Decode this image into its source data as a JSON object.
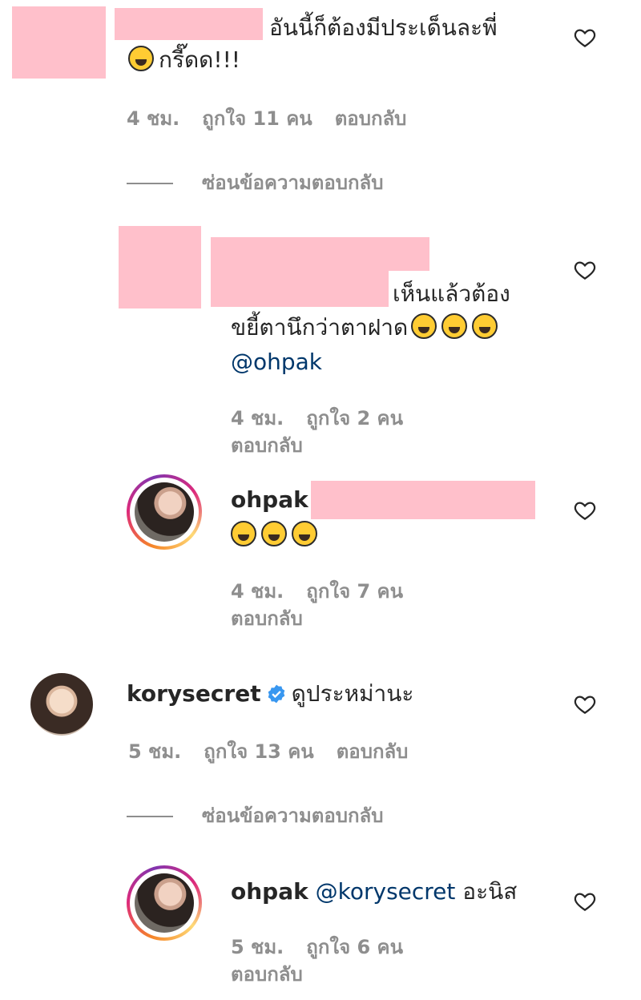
{
  "heart_icon": "heart-outline-icon",
  "colors": {
    "muted": "#8e8e8e",
    "mention": "#00376b",
    "redaction": "#ffc0cb",
    "verified": "#3897f0"
  },
  "comment1": {
    "text_line1": "อันนี้ก็ต้องมีประเด็นละพี่",
    "text_line2": "กรี๊ดด!!!",
    "time": "4 ชม.",
    "likes": "ถูกใจ 11 คน",
    "reply": "ตอบกลับ"
  },
  "hide_replies_1": "ซ่อนข้อความตอบกลับ",
  "reply1": {
    "text_line1": "เห็นแล้วต้อง",
    "text_line2": "ขยี้ตานึกว่าตาฝาด",
    "mention": "@ohpak",
    "time": "4 ชม.",
    "likes": "ถูกใจ 2 คน",
    "reply": "ตอบกลับ"
  },
  "reply2": {
    "username": "ohpak",
    "time": "4 ชม.",
    "likes": "ถูกใจ 7 คน",
    "reply": "ตอบกลับ"
  },
  "comment2": {
    "username": "korysecret",
    "text": "ดูประหม่านะ",
    "time": "5 ชม.",
    "likes": "ถูกใจ 13 คน",
    "reply": "ตอบกลับ"
  },
  "hide_replies_2": "ซ่อนข้อความตอบกลับ",
  "reply3": {
    "username": "ohpak",
    "mention": "@korysecret",
    "text": "อะนิส",
    "time": "5 ชม.",
    "likes": "ถูกใจ 6 คน",
    "reply": "ตอบกลับ"
  }
}
